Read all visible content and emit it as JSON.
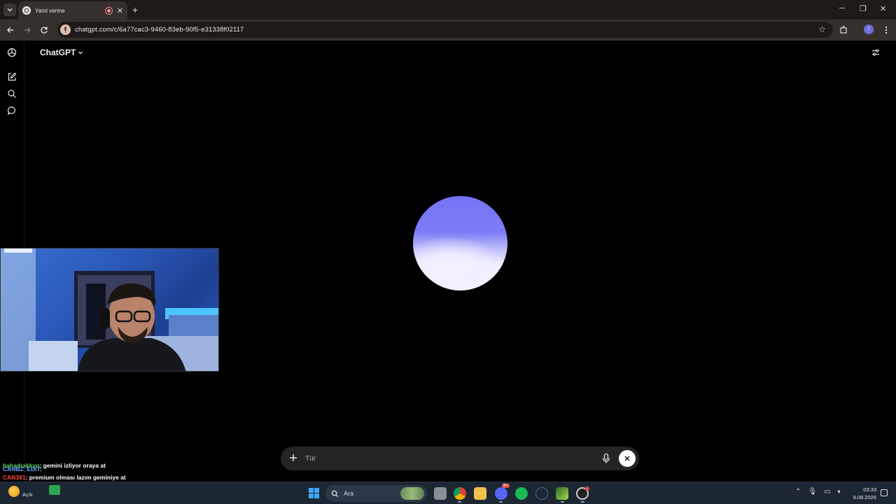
{
  "browser": {
    "tab_title": "Yanıt verme",
    "url": "chatgpt.com/c/6a77cac3-9460-83eb-90f5-e31338f02117",
    "profile_initial": "I"
  },
  "app": {
    "model_title": "ChatGPT"
  },
  "composer": {
    "placeholder": "Tür"
  },
  "chat_overlay": {
    "lines": [
      {
        "user": "bahadrakkyn",
        "message": ": gemini izliyor oraya at",
        "user_color": "#58d858"
      },
      {
        "user": "CAN381",
        "message": ": premium olması lazım geminiye at",
        "user_color": "#ff4a3d"
      },
      {
        "user": "CANBZ_EDIT",
        "message": ":",
        "user_color": "#6aa6ff"
      }
    ]
  },
  "taskbar": {
    "weather_label": "Açık",
    "search_placeholder": "Ara",
    "discord_badge": "9+",
    "time": "03:33",
    "date": "9.08.2026"
  }
}
